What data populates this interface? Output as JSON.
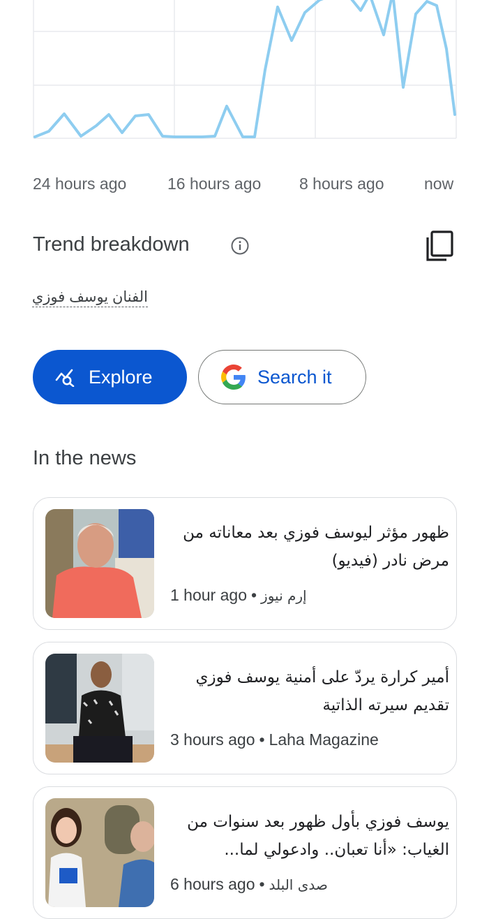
{
  "trend_chart": {
    "x_tick_labels": [
      "24 hours ago",
      "16 hours ago",
      "8 hours ago",
      "now"
    ],
    "line_color": "#8ecdf0",
    "grid_color": "#e8eaed"
  },
  "trend_breakdown": {
    "title": "Trend breakdown",
    "query": "الفنان يوسف فوزي"
  },
  "actions": {
    "explore_label": "Explore",
    "search_label": "Search it",
    "explore_color": "#0b57d0"
  },
  "news": {
    "heading": "In the news",
    "items": [
      {
        "title": "ظهور مؤثر ليوسف فوزي بعد معاناته من مرض نادر (فيديو)",
        "time": "1 hour ago",
        "source": "إرم نيوز"
      },
      {
        "title": "أمير كرارة يردّ على أمنية يوسف فوزي تقديم سيرته الذاتية",
        "time": "3 hours ago",
        "source": "Laha Magazine"
      },
      {
        "title": "يوسف فوزي بأول ظهور بعد سنوات من الغياب: «أنا تعبان.. وادعولي لما...",
        "time": "6 hours ago",
        "source": "صدى البلد"
      }
    ]
  }
}
